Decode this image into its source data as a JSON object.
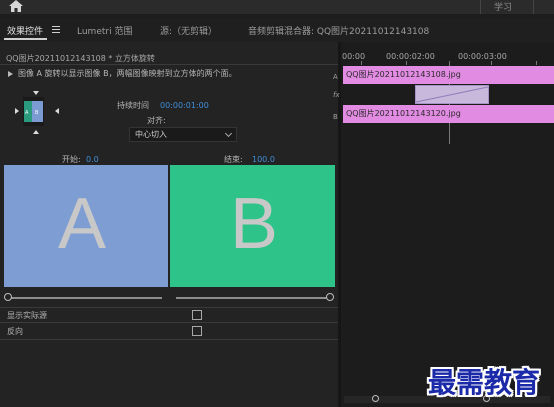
{
  "topbar": {
    "workspace_learn": "学习"
  },
  "tabs": [
    {
      "label": "效果控件"
    },
    {
      "label": "Lumetri 范围"
    },
    {
      "label": "源:（无剪辑）"
    },
    {
      "label": "音频剪辑混合器: QQ图片20211012143108"
    }
  ],
  "effect_controls": {
    "clip_title": "QQ图片20211012143108 * 立方体旋转",
    "description": "图像 A 旋转以显示图像 B，两幅图像映射到立方体的两个面。",
    "duration_label": "持续时间",
    "duration_value": "00:00:01:00",
    "alignment_label": "对齐:",
    "alignment_value": "中心切入",
    "start_label": "开始:",
    "start_value": "0.0",
    "end_label": "结束:",
    "end_value": "100.0",
    "panel_a_letter": "A",
    "panel_b_letter": "B",
    "thumb_a": "A",
    "thumb_b": "B",
    "show_actual_sources_label": "显示实际源",
    "reverse_label": "反向",
    "start_slider_fraction": 0.0,
    "end_slider_fraction": 1.0
  },
  "timeline": {
    "ruler_labels": [
      "00:00",
      "00:00:02:00",
      "00:00:03:00"
    ],
    "track_headers": [
      "A",
      "fx",
      "B"
    ],
    "clip_a_name": "QQ图片20211012143108.jpg",
    "clip_b_name": "QQ图片20211012143120.jpg"
  },
  "watermark": "最需教育",
  "colors": {
    "panel_a": "#7d9dd3",
    "panel_b": "#2ec388",
    "clip": "#e28be2",
    "transition": "#c7b8dc",
    "value_blue": "#3f8fd8"
  }
}
